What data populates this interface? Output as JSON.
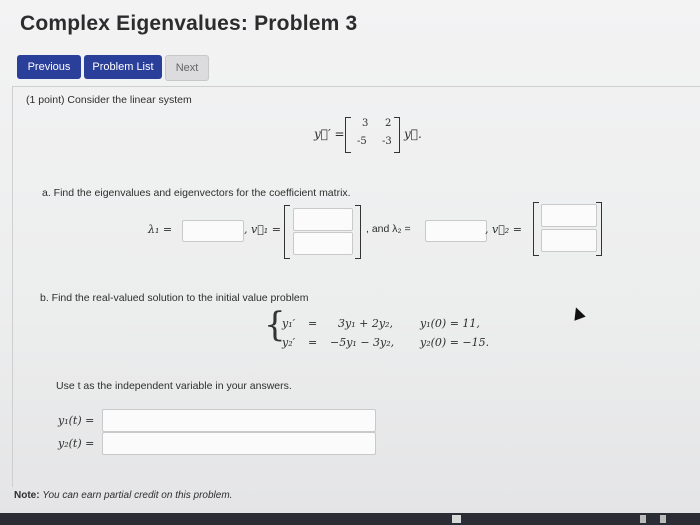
{
  "page": {
    "title": "Complex Eigenvalues: Problem 3"
  },
  "nav": {
    "previous": "Previous",
    "problem_list": "Problem List",
    "next": "Next"
  },
  "problem": {
    "intro": "(1 point) Consider the linear system",
    "system": {
      "lhs": "y⃗′ =",
      "matrix": [
        [
          "3",
          "2"
        ],
        [
          "-5",
          "-3"
        ]
      ],
      "rhs": "y⃗."
    },
    "part_a": {
      "text": "a. Find the eigenvalues and eigenvectors for the coefficient matrix.",
      "lambda1_label": "λ₁ =",
      "v1_label": ", v⃗₁ =",
      "and_label": ", and λ₂ =",
      "v2_label": ", v⃗₂ ="
    },
    "part_b": {
      "text": "b. Find the real-valued solution to the initial value problem",
      "eq1_lhs": "y₁′",
      "eq1_rhs": "3y₁ + 2y₂,",
      "eq1_ic": "y₁(0) = 11,",
      "eq2_lhs": "y₂′",
      "eq2_rhs": "−5y₁ − 3y₂,",
      "eq2_ic": "y₂(0) = −15.",
      "equals": "=",
      "instruction": "Use t as the independent variable in your answers.",
      "y1_label": "y₁(t) =",
      "y2_label": "y₂(t) ="
    }
  },
  "note": {
    "label": "Note:",
    "text": "You can earn partial credit on this problem."
  }
}
